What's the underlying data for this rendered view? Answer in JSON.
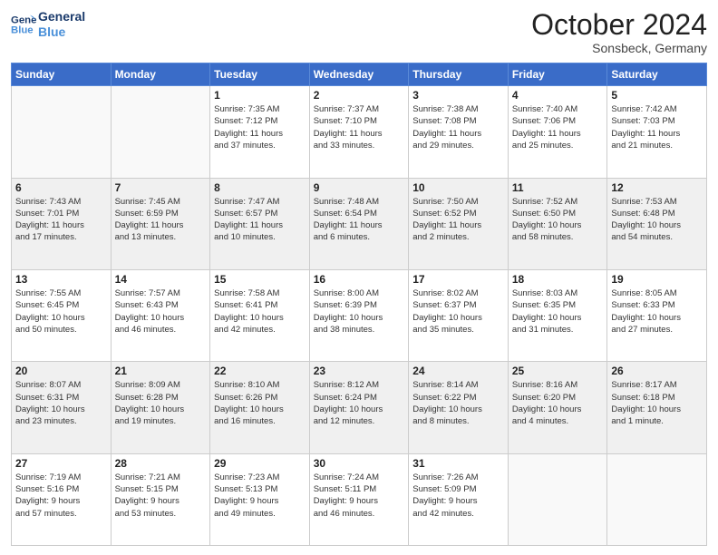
{
  "header": {
    "logo_line1": "General",
    "logo_line2": "Blue",
    "month": "October 2024",
    "location": "Sonsbeck, Germany"
  },
  "weekdays": [
    "Sunday",
    "Monday",
    "Tuesday",
    "Wednesday",
    "Thursday",
    "Friday",
    "Saturday"
  ],
  "weeks": [
    [
      {
        "day": "",
        "detail": ""
      },
      {
        "day": "",
        "detail": ""
      },
      {
        "day": "1",
        "detail": "Sunrise: 7:35 AM\nSunset: 7:12 PM\nDaylight: 11 hours\nand 37 minutes."
      },
      {
        "day": "2",
        "detail": "Sunrise: 7:37 AM\nSunset: 7:10 PM\nDaylight: 11 hours\nand 33 minutes."
      },
      {
        "day": "3",
        "detail": "Sunrise: 7:38 AM\nSunset: 7:08 PM\nDaylight: 11 hours\nand 29 minutes."
      },
      {
        "day": "4",
        "detail": "Sunrise: 7:40 AM\nSunset: 7:06 PM\nDaylight: 11 hours\nand 25 minutes."
      },
      {
        "day": "5",
        "detail": "Sunrise: 7:42 AM\nSunset: 7:03 PM\nDaylight: 11 hours\nand 21 minutes."
      }
    ],
    [
      {
        "day": "6",
        "detail": "Sunrise: 7:43 AM\nSunset: 7:01 PM\nDaylight: 11 hours\nand 17 minutes."
      },
      {
        "day": "7",
        "detail": "Sunrise: 7:45 AM\nSunset: 6:59 PM\nDaylight: 11 hours\nand 13 minutes."
      },
      {
        "day": "8",
        "detail": "Sunrise: 7:47 AM\nSunset: 6:57 PM\nDaylight: 11 hours\nand 10 minutes."
      },
      {
        "day": "9",
        "detail": "Sunrise: 7:48 AM\nSunset: 6:54 PM\nDaylight: 11 hours\nand 6 minutes."
      },
      {
        "day": "10",
        "detail": "Sunrise: 7:50 AM\nSunset: 6:52 PM\nDaylight: 11 hours\nand 2 minutes."
      },
      {
        "day": "11",
        "detail": "Sunrise: 7:52 AM\nSunset: 6:50 PM\nDaylight: 10 hours\nand 58 minutes."
      },
      {
        "day": "12",
        "detail": "Sunrise: 7:53 AM\nSunset: 6:48 PM\nDaylight: 10 hours\nand 54 minutes."
      }
    ],
    [
      {
        "day": "13",
        "detail": "Sunrise: 7:55 AM\nSunset: 6:45 PM\nDaylight: 10 hours\nand 50 minutes."
      },
      {
        "day": "14",
        "detail": "Sunrise: 7:57 AM\nSunset: 6:43 PM\nDaylight: 10 hours\nand 46 minutes."
      },
      {
        "day": "15",
        "detail": "Sunrise: 7:58 AM\nSunset: 6:41 PM\nDaylight: 10 hours\nand 42 minutes."
      },
      {
        "day": "16",
        "detail": "Sunrise: 8:00 AM\nSunset: 6:39 PM\nDaylight: 10 hours\nand 38 minutes."
      },
      {
        "day": "17",
        "detail": "Sunrise: 8:02 AM\nSunset: 6:37 PM\nDaylight: 10 hours\nand 35 minutes."
      },
      {
        "day": "18",
        "detail": "Sunrise: 8:03 AM\nSunset: 6:35 PM\nDaylight: 10 hours\nand 31 minutes."
      },
      {
        "day": "19",
        "detail": "Sunrise: 8:05 AM\nSunset: 6:33 PM\nDaylight: 10 hours\nand 27 minutes."
      }
    ],
    [
      {
        "day": "20",
        "detail": "Sunrise: 8:07 AM\nSunset: 6:31 PM\nDaylight: 10 hours\nand 23 minutes."
      },
      {
        "day": "21",
        "detail": "Sunrise: 8:09 AM\nSunset: 6:28 PM\nDaylight: 10 hours\nand 19 minutes."
      },
      {
        "day": "22",
        "detail": "Sunrise: 8:10 AM\nSunset: 6:26 PM\nDaylight: 10 hours\nand 16 minutes."
      },
      {
        "day": "23",
        "detail": "Sunrise: 8:12 AM\nSunset: 6:24 PM\nDaylight: 10 hours\nand 12 minutes."
      },
      {
        "day": "24",
        "detail": "Sunrise: 8:14 AM\nSunset: 6:22 PM\nDaylight: 10 hours\nand 8 minutes."
      },
      {
        "day": "25",
        "detail": "Sunrise: 8:16 AM\nSunset: 6:20 PM\nDaylight: 10 hours\nand 4 minutes."
      },
      {
        "day": "26",
        "detail": "Sunrise: 8:17 AM\nSunset: 6:18 PM\nDaylight: 10 hours\nand 1 minute."
      }
    ],
    [
      {
        "day": "27",
        "detail": "Sunrise: 7:19 AM\nSunset: 5:16 PM\nDaylight: 9 hours\nand 57 minutes."
      },
      {
        "day": "28",
        "detail": "Sunrise: 7:21 AM\nSunset: 5:15 PM\nDaylight: 9 hours\nand 53 minutes."
      },
      {
        "day": "29",
        "detail": "Sunrise: 7:23 AM\nSunset: 5:13 PM\nDaylight: 9 hours\nand 49 minutes."
      },
      {
        "day": "30",
        "detail": "Sunrise: 7:24 AM\nSunset: 5:11 PM\nDaylight: 9 hours\nand 46 minutes."
      },
      {
        "day": "31",
        "detail": "Sunrise: 7:26 AM\nSunset: 5:09 PM\nDaylight: 9 hours\nand 42 minutes."
      },
      {
        "day": "",
        "detail": ""
      },
      {
        "day": "",
        "detail": ""
      }
    ]
  ]
}
